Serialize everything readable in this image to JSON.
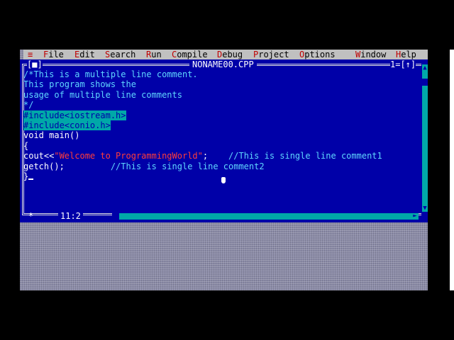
{
  "menu": {
    "system": "≡",
    "items": [
      {
        "hot": "F",
        "rest": "ile"
      },
      {
        "hot": "E",
        "rest": "dit"
      },
      {
        "hot": "S",
        "rest": "earch"
      },
      {
        "hot": "R",
        "rest": "un"
      },
      {
        "hot": "C",
        "rest": "ompile"
      },
      {
        "hot": "D",
        "rest": "ebug"
      },
      {
        "hot": "P",
        "rest": "roject"
      },
      {
        "hot": "O",
        "rest": "ptions"
      },
      {
        "hot": "W",
        "rest": "indow"
      },
      {
        "hot": "H",
        "rest": "elp"
      }
    ]
  },
  "window": {
    "close_box": "[■]",
    "title": "NONAME00.CPP",
    "number": "1=[↑]",
    "cursor_pos": "11:2",
    "modified_marker": "*"
  },
  "code": {
    "l1": "/*This is a multiple line comment.",
    "l2": "This program shows the",
    "l3": "usage of multiple line comments",
    "l4": "*/",
    "l5": "#include<iostream.h>",
    "l6": "#include<conio.h>",
    "l7": "void main()",
    "l8": "{",
    "l9_a": "cout<<",
    "l9_str": "\"Welcome to ProgrammingWorld\"",
    "l9_b": ";",
    "l9_c": "//This is single line comment1",
    "l10_a": "getch();",
    "l10_c": "//This is single line comment2",
    "l11": "}"
  },
  "colors": {
    "editor_bg": "#0000a8",
    "comment": "#5fd7ff",
    "string": "#ff3c3c",
    "menu_bg": "#c0c0c0",
    "hotkey": "#c00000"
  }
}
